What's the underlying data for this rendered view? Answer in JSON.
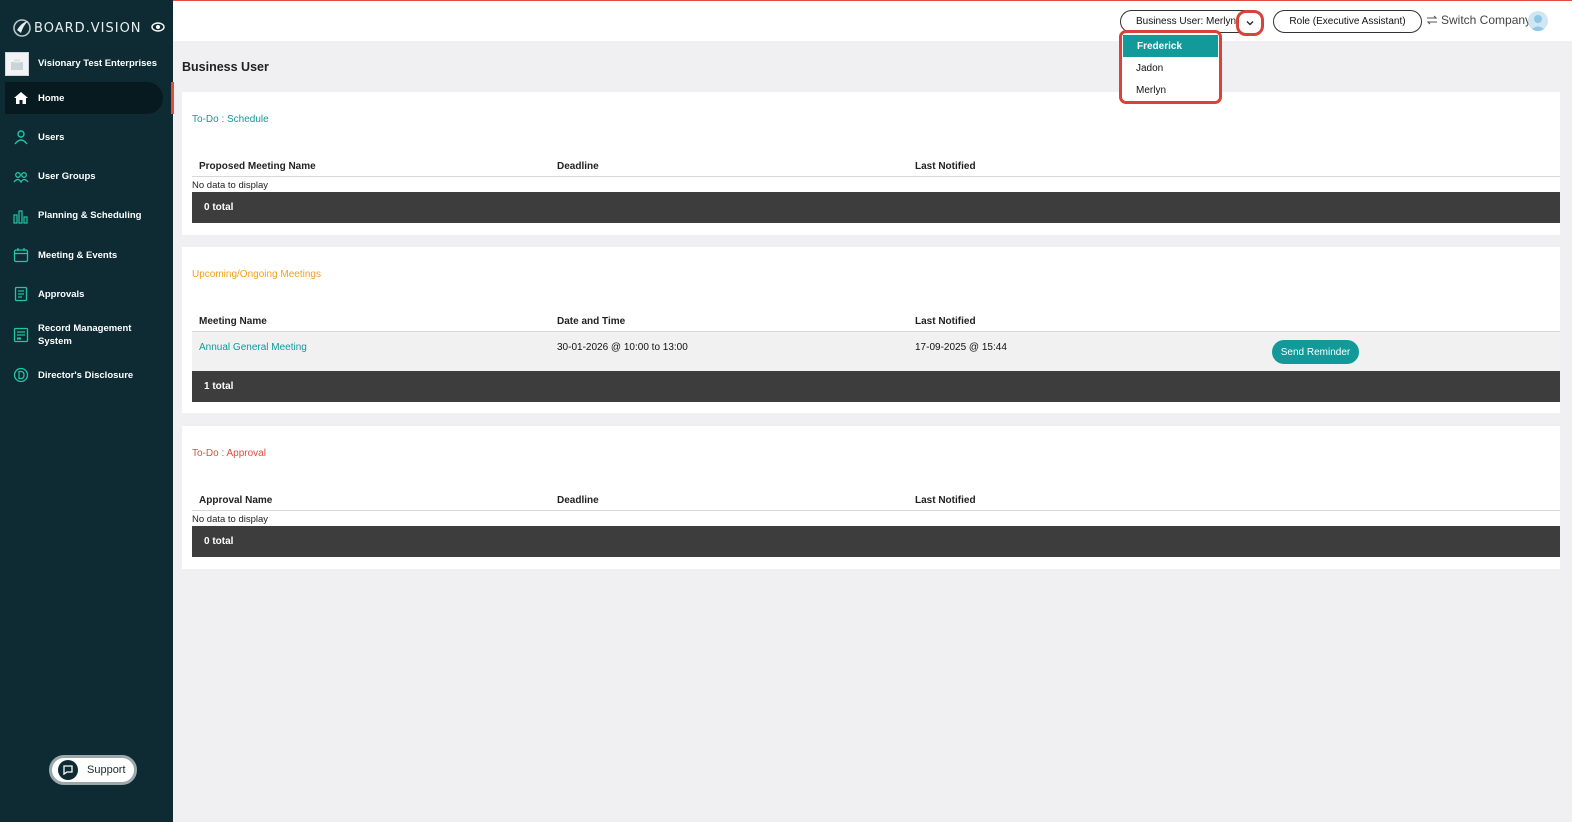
{
  "app": {
    "brand": "BOARD.VISION",
    "company": "Visionary Test Enterprises"
  },
  "sidebar": {
    "items": [
      {
        "label": "Home",
        "icon": "home-icon"
      },
      {
        "label": "Users",
        "icon": "user-icon"
      },
      {
        "label": "User Groups",
        "icon": "user-group-icon"
      },
      {
        "label": "Planning & Scheduling",
        "icon": "bar-chart-icon"
      },
      {
        "label": "Meeting & Events",
        "icon": "calendar-icon"
      },
      {
        "label": "Approvals",
        "icon": "document-icon"
      },
      {
        "label": "Record Management\nSystem",
        "icon": "records-icon"
      },
      {
        "label": "Director's Disclosure",
        "icon": "disclosure-icon"
      }
    ],
    "support_label": "Support"
  },
  "topbar": {
    "business_user_label": "Business User: Merlyn",
    "role_label": "Role (Executive Assistant)",
    "switch_company_label": "Switch Company"
  },
  "dropdown": {
    "options": [
      "Frederick",
      "Jadon",
      "Merlyn"
    ],
    "selected": "Frederick"
  },
  "page": {
    "title": "Business User"
  },
  "schedule": {
    "title": "To-Do : Schedule",
    "columns": [
      "Proposed Meeting Name",
      "Deadline",
      "Last Notified"
    ],
    "empty_text": "No data to display",
    "total": "0 total"
  },
  "meetings": {
    "title": "Upcoming/Ongoing Meetings",
    "columns": [
      "Meeting Name",
      "Date and Time",
      "Last Notified"
    ],
    "rows": [
      {
        "name": "Annual General Meeting",
        "datetime": "30-01-2026 @ 10:00 to 13:00",
        "last_notified": "17-09-2025 @ 15:44",
        "action": "Send Reminder"
      }
    ],
    "total": "1 total"
  },
  "approval": {
    "title": "To-Do : Approval",
    "columns": [
      "Approval Name",
      "Deadline",
      "Last Notified"
    ],
    "empty_text": "No data to display",
    "total": "0 total"
  },
  "colors": {
    "sidebar": "#0e2b33",
    "accent": "#12999a",
    "schedule_title": "#12999a",
    "meetings_title": "#f0a020",
    "approval_title": "#e24c3f",
    "highlight": "#d9423a"
  }
}
